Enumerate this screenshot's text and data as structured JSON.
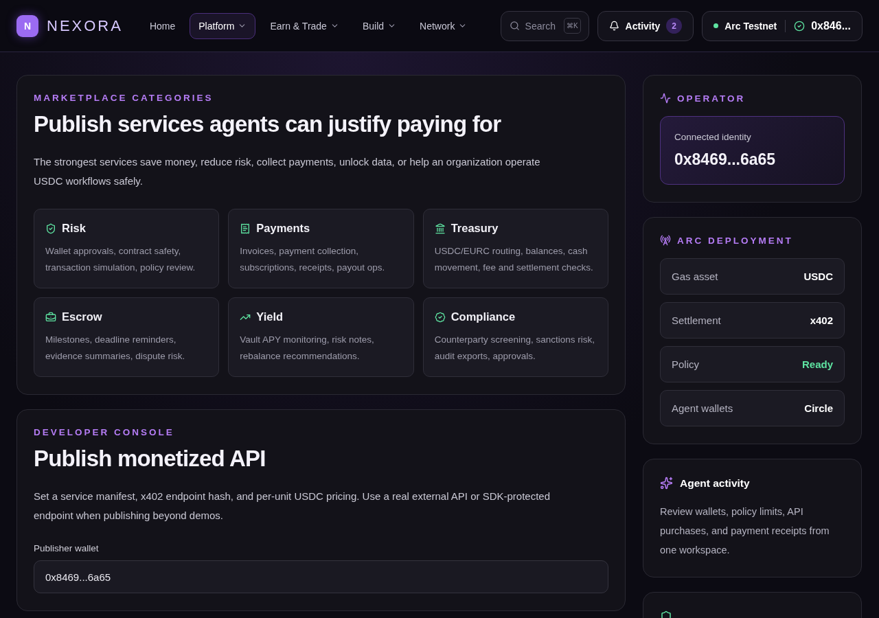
{
  "brand": {
    "mark": "N",
    "name": "NEXORA"
  },
  "nav": [
    {
      "label": "Home",
      "selected": false,
      "has_menu": false
    },
    {
      "label": "Platform",
      "selected": true,
      "has_menu": true
    },
    {
      "label": "Earn & Trade",
      "selected": false,
      "has_menu": true
    },
    {
      "label": "Build",
      "selected": false,
      "has_menu": true
    },
    {
      "label": "Network",
      "selected": false,
      "has_menu": true
    }
  ],
  "search": {
    "placeholder": "Search",
    "shortcut": "⌘K"
  },
  "activity": {
    "label": "Activity",
    "count": "2"
  },
  "wallet": {
    "network": "Arc Testnet",
    "connected": true,
    "address": "0x846..."
  },
  "categories": {
    "eyebrow": "MARKETPLACE CATEGORIES",
    "title": "Publish services agents can justify paying for",
    "intro": "The strongest services save money, reduce risk, collect payments, unlock data, or help an organization operate USDC workflows safely.",
    "items": [
      {
        "title": "Risk",
        "text": "Wallet approvals, contract safety, transaction simulation, policy review."
      },
      {
        "title": "Payments",
        "text": "Invoices, payment collection, subscriptions, receipts, payout ops."
      },
      {
        "title": "Treasury",
        "text": "USDC/EURC routing, balances, cash movement, fee and settlement checks."
      },
      {
        "title": "Escrow",
        "text": "Milestones, deadline reminders, evidence summaries, dispute risk."
      },
      {
        "title": "Yield",
        "text": "Vault APY monitoring, risk notes, rebalance recommendations."
      },
      {
        "title": "Compliance",
        "text": "Counterparty screening, sanctions risk, audit exports, approvals."
      }
    ]
  },
  "console": {
    "eyebrow": "DEVELOPER CONSOLE",
    "title": "Publish monetized API",
    "intro": "Set a service manifest, x402 endpoint hash, and per-unit USDC pricing. Use a real external API or SDK-protected endpoint when publishing beyond demos.",
    "field_label": "Publisher wallet",
    "field_value": "0x8469...6a65"
  },
  "operator": {
    "eyebrow": "OPERATOR",
    "label": "Connected identity",
    "address": "0x8469...6a65"
  },
  "deployment": {
    "eyebrow": "ARC DEPLOYMENT",
    "rows": [
      {
        "label": "Gas asset",
        "value": "USDC",
        "highlighted": false
      },
      {
        "label": "Settlement",
        "value": "x402",
        "highlighted": false
      },
      {
        "label": "Policy",
        "value": "Ready",
        "highlighted": true
      },
      {
        "label": "Agent wallets",
        "value": "Circle",
        "highlighted": false
      }
    ]
  },
  "agent_activity": {
    "title": "Agent activity",
    "text": "Review wallets, policy limits, API purchases, and payment receipts from one workspace."
  }
}
